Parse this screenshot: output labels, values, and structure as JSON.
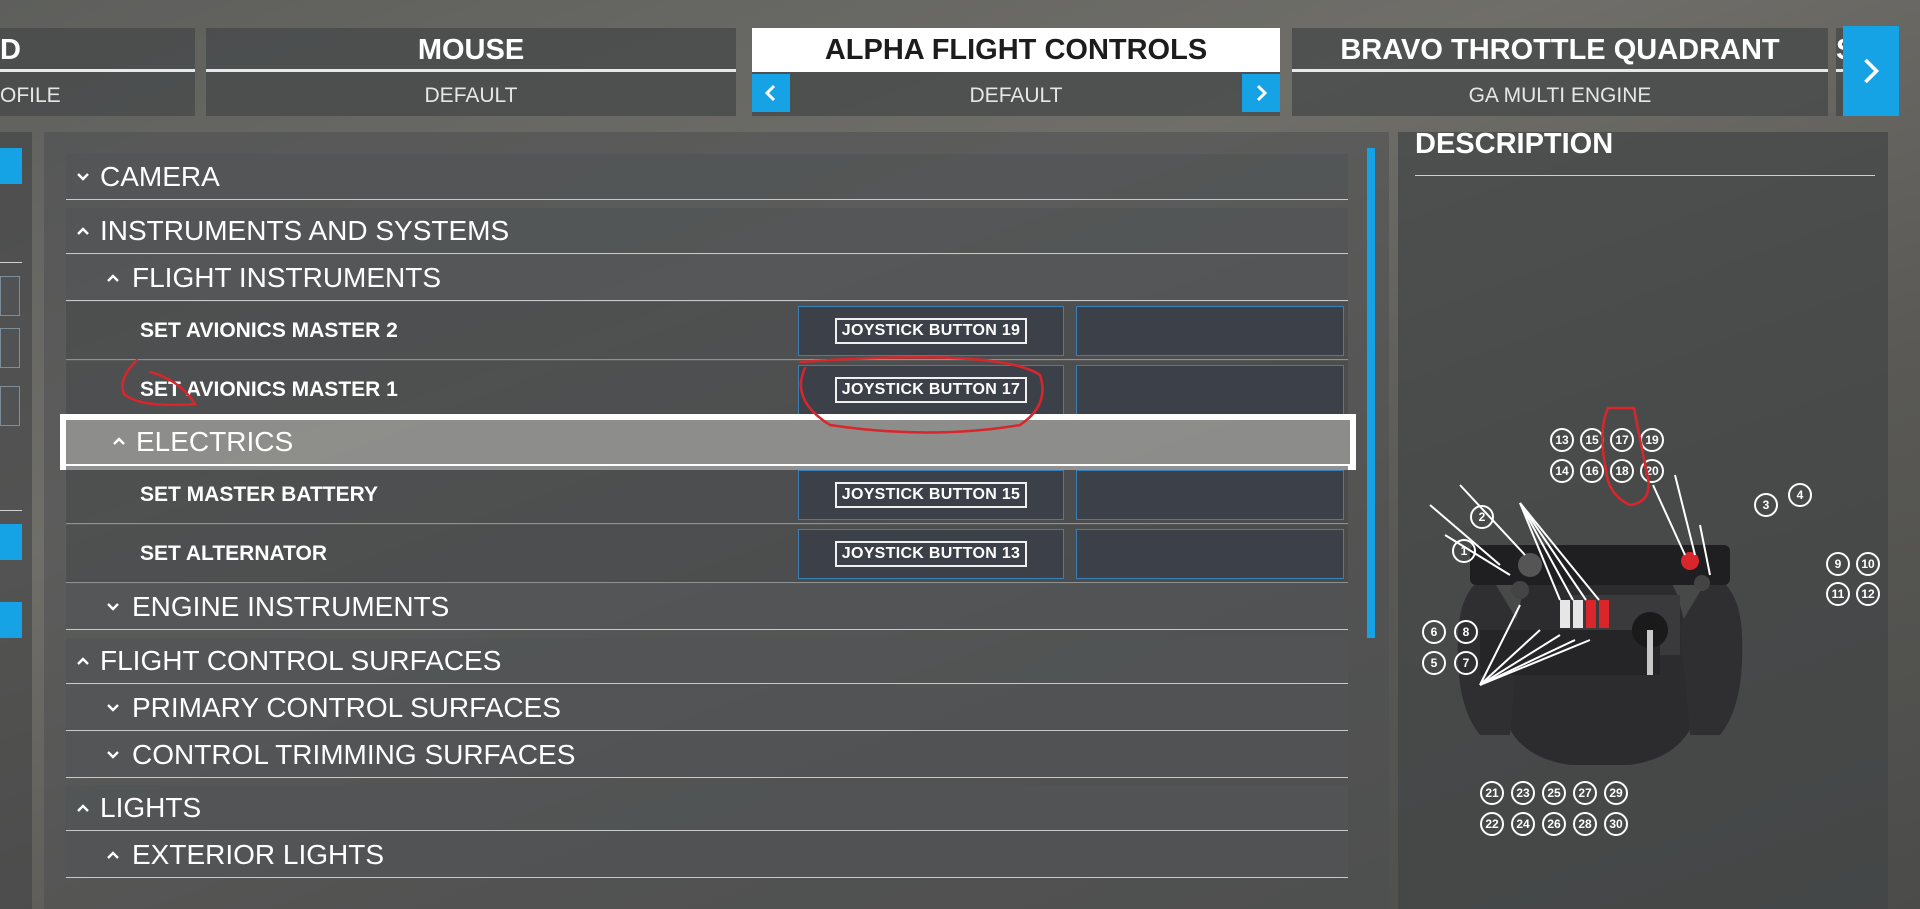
{
  "devices": [
    {
      "name": "D",
      "profile": "OFILE"
    },
    {
      "name": "MOUSE",
      "profile": "DEFAULT"
    },
    {
      "name": "ALPHA FLIGHT CONTROLS",
      "profile": "DEFAULT"
    },
    {
      "name": "BRAVO THROTTLE QUADRANT",
      "profile": "GA MULTI ENGINE"
    },
    {
      "name": "S"
    }
  ],
  "rows": {
    "camera": "CAMERA",
    "instruments_systems": "INSTRUMENTS AND SYSTEMS",
    "flight_instruments": "FLIGHT INSTRUMENTS",
    "set_avionics_2": {
      "label": "SET AVIONICS MASTER 2",
      "binding": "JOYSTICK BUTTON 19"
    },
    "set_avionics_1": {
      "label": "SET AVIONICS MASTER 1",
      "binding": "JOYSTICK BUTTON 17"
    },
    "electrics": "ELECTRICS",
    "set_master_battery": {
      "label": "SET MASTER BATTERY",
      "binding": "JOYSTICK BUTTON 15"
    },
    "set_alternator": {
      "label": "SET ALTERNATOR",
      "binding": "JOYSTICK BUTTON 13"
    },
    "engine_instruments": "ENGINE INSTRUMENTS",
    "flight_control_surfaces": "FLIGHT CONTROL SURFACES",
    "primary_control_surfaces": "PRIMARY CONTROL SURFACES",
    "control_trimming_surfaces": "CONTROL TRIMMING SURFACES",
    "lights": "LIGHTS",
    "exterior_lights": "EXTERIOR LIGHTS"
  },
  "description": {
    "title": "DESCRIPTION",
    "callouts": [
      "1",
      "2",
      "3",
      "4",
      "5",
      "6",
      "7",
      "8",
      "9",
      "10",
      "11",
      "12",
      "13",
      "14",
      "15",
      "16",
      "17",
      "18",
      "19",
      "20",
      "21",
      "22",
      "23",
      "24",
      "25",
      "26",
      "27",
      "28",
      "29",
      "30"
    ]
  },
  "colors": {
    "accent": "#16a3e6",
    "annotation": "#d8262b"
  },
  "icons": {
    "prev": "chevron-left-icon",
    "next": "chevron-right-icon",
    "expanded": "chevron-up-icon",
    "collapsed": "chevron-down-icon"
  }
}
